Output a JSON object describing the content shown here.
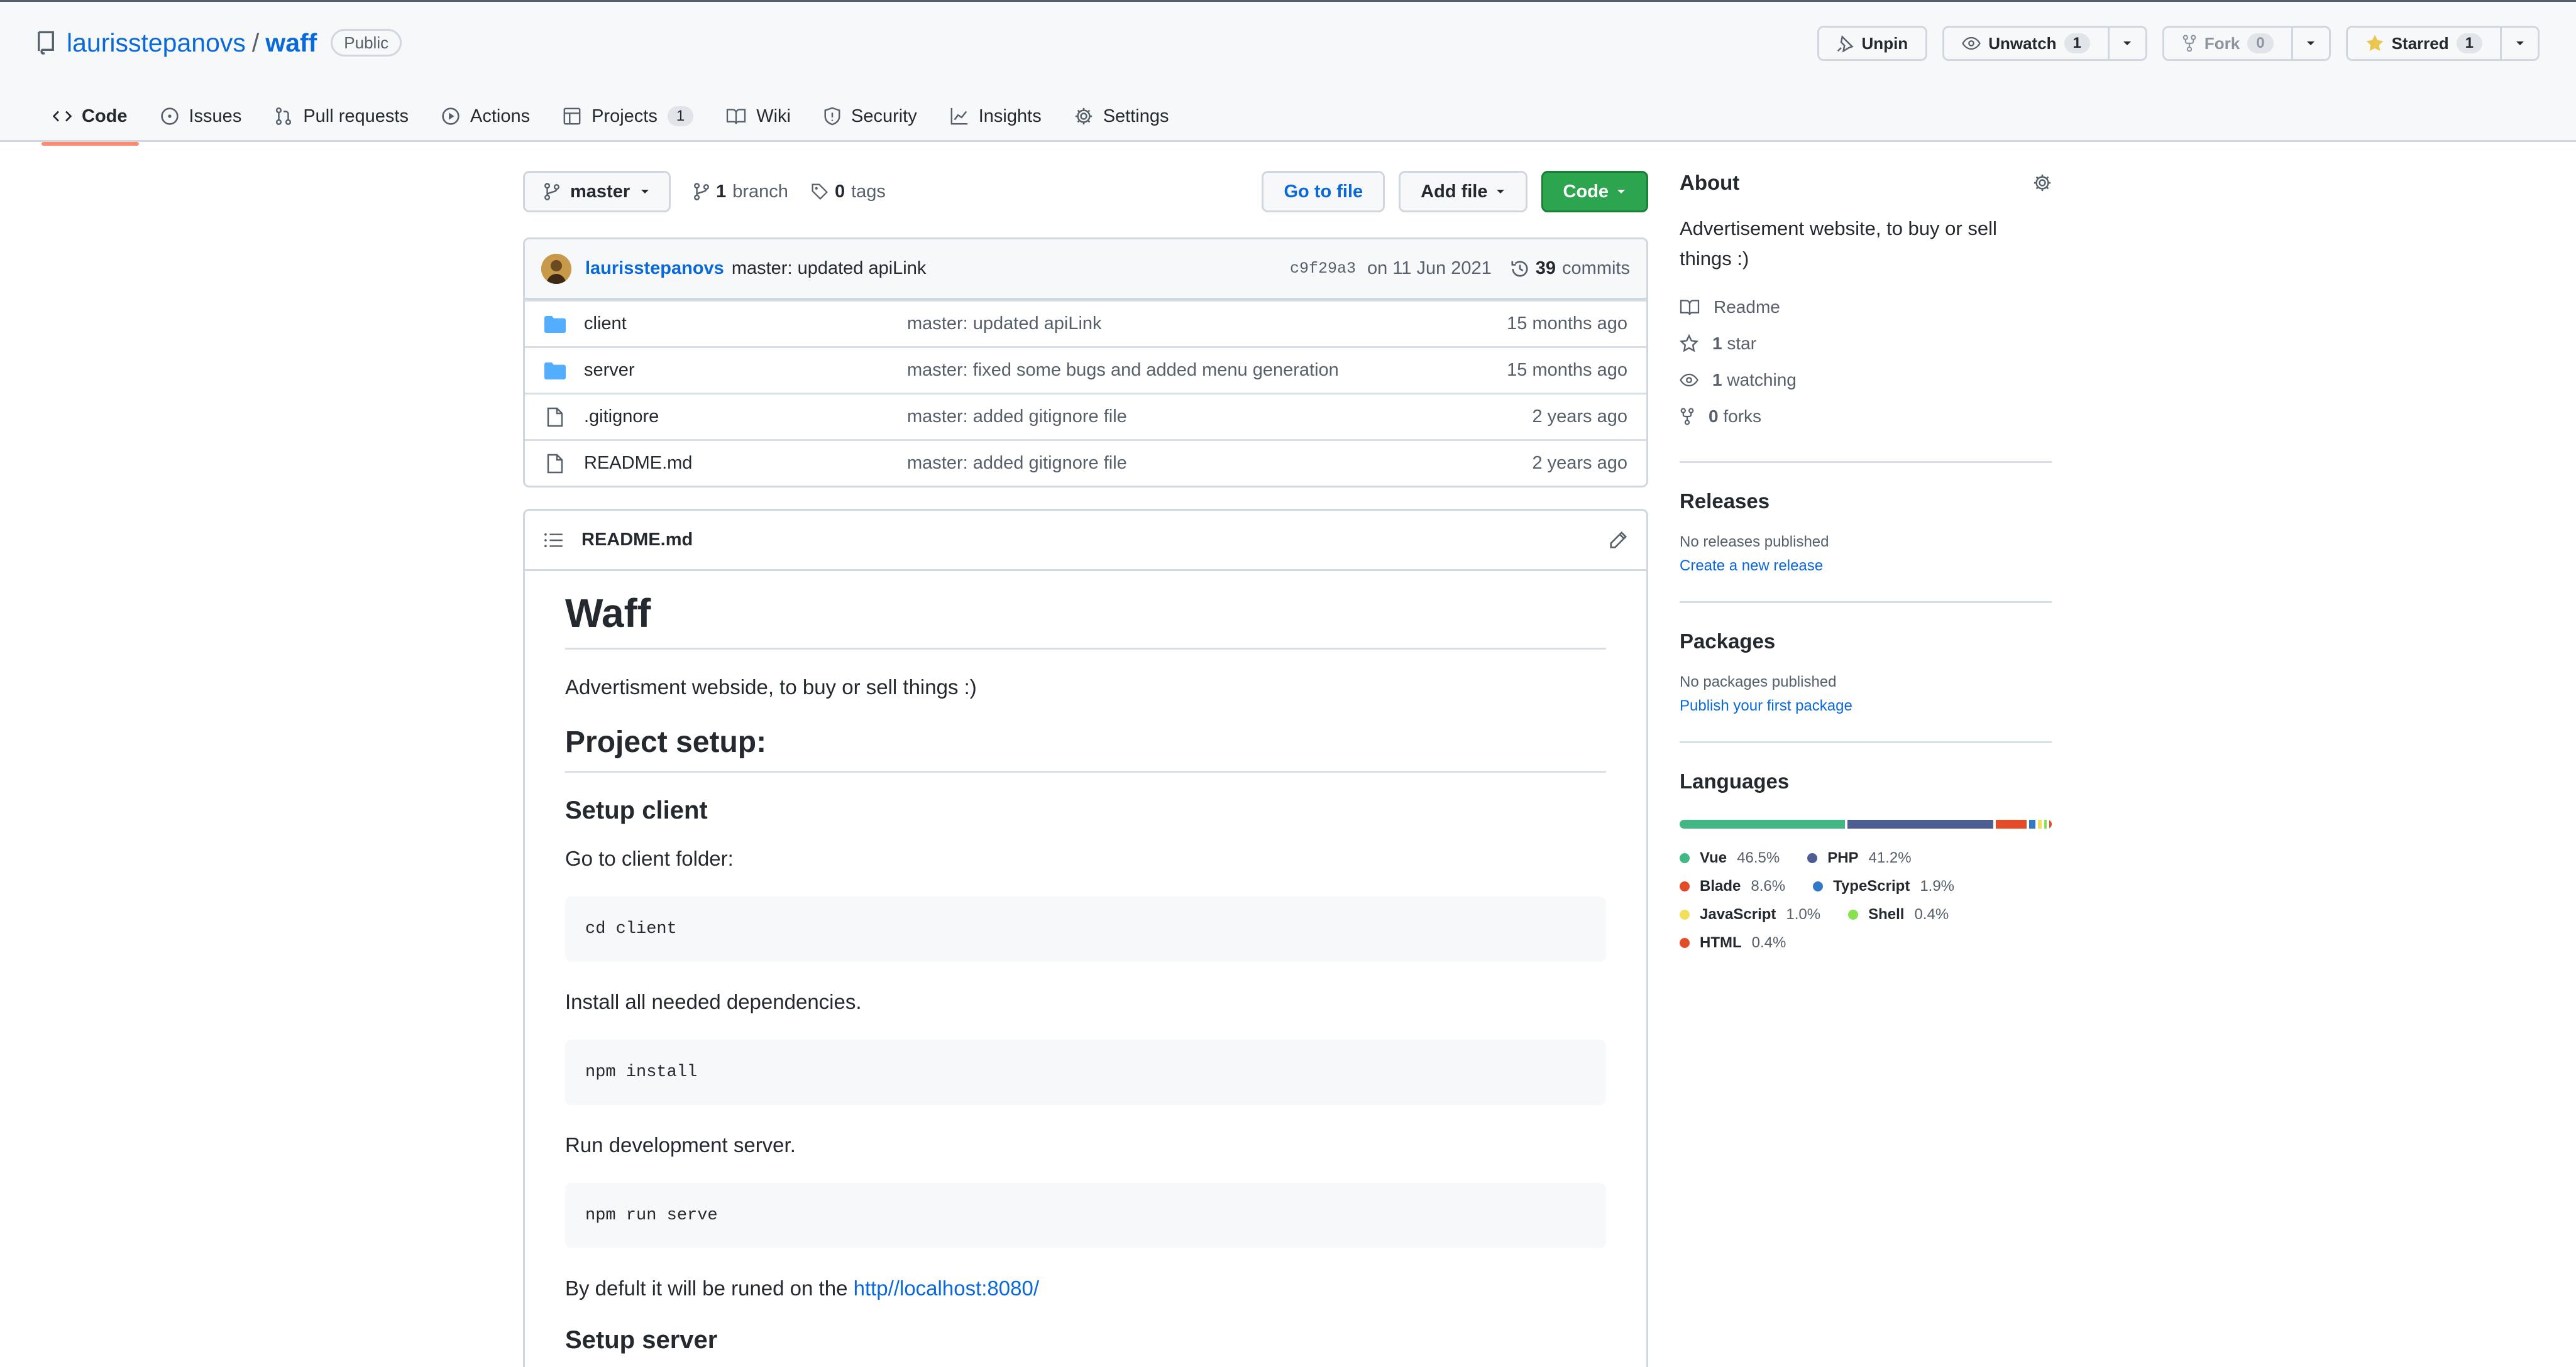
{
  "repo": {
    "owner": "laurisstepanovs",
    "separator": "/",
    "name": "waff",
    "visibility": "Public"
  },
  "actions": {
    "unpin": "Unpin",
    "unwatch": "Unwatch",
    "watch_count": "1",
    "fork": "Fork",
    "fork_count": "0",
    "starred": "Starred",
    "star_count": "1"
  },
  "tabs": [
    {
      "label": "Code",
      "icon": "code-icon"
    },
    {
      "label": "Issues",
      "icon": "issue-opened-icon"
    },
    {
      "label": "Pull requests",
      "icon": "git-pull-request-icon"
    },
    {
      "label": "Actions",
      "icon": "play-icon"
    },
    {
      "label": "Projects",
      "icon": "table-icon",
      "count": "1"
    },
    {
      "label": "Wiki",
      "icon": "book-icon"
    },
    {
      "label": "Security",
      "icon": "shield-icon"
    },
    {
      "label": "Insights",
      "icon": "graph-icon"
    },
    {
      "label": "Settings",
      "icon": "gear-icon"
    }
  ],
  "toolbar": {
    "branch": "master",
    "branch_count": "1",
    "branch_label": "branch",
    "tag_count": "0",
    "tag_label": "tags",
    "go_to_file": "Go to file",
    "add_file": "Add file",
    "code": "Code"
  },
  "commit": {
    "author": "laurisstepanovs",
    "message": "master: updated apiLink",
    "sha": "c9f29a3",
    "date": "on 11 Jun 2021",
    "count": "39",
    "count_label": "commits"
  },
  "files": [
    {
      "type": "dir",
      "name": "client",
      "message": "master: updated apiLink",
      "age": "15 months ago"
    },
    {
      "type": "dir",
      "name": "server",
      "message": "master: fixed some bugs and added menu generation",
      "age": "15 months ago"
    },
    {
      "type": "file",
      "name": ".gitignore",
      "message": "master: added gitignore file",
      "age": "2 years ago"
    },
    {
      "type": "file",
      "name": "README.md",
      "message": "master: added gitignore file",
      "age": "2 years ago"
    }
  ],
  "readme": {
    "filename": "README.md",
    "h1": "Waff",
    "intro": "Advertisment webside, to buy or sell things :)",
    "h2_setup": "Project setup:",
    "h3_client": "Setup client",
    "p_goto": "Go to client folder:",
    "code_cd": "cd client",
    "p_install": "Install all needed dependencies.",
    "code_install": "npm install",
    "p_run": "Run development server.",
    "code_serve": "npm run serve",
    "p_default_prefix": "By defult it will be runed on the ",
    "default_link": "http//localhost:8080/",
    "h3_server": "Setup server"
  },
  "about": {
    "heading": "About",
    "description": "Advertisement website, to buy or sell things :)",
    "readme": "Readme",
    "stars_count": "1",
    "stars_label": "star",
    "watching_count": "1",
    "watching_label": "watching",
    "forks_count": "0",
    "forks_label": "forks"
  },
  "releases": {
    "heading": "Releases",
    "empty": "No releases published",
    "link": "Create a new release"
  },
  "packages": {
    "heading": "Packages",
    "empty": "No packages published",
    "link": "Publish your first package"
  },
  "languages": {
    "heading": "Languages",
    "items": [
      {
        "name": "Vue",
        "pct": "46.5%",
        "value": 46.5,
        "color": "#41b883"
      },
      {
        "name": "PHP",
        "pct": "41.2%",
        "value": 41.2,
        "color": "#4F5D95"
      },
      {
        "name": "Blade",
        "pct": "8.6%",
        "value": 8.6,
        "color": "#e34c26"
      },
      {
        "name": "TypeScript",
        "pct": "1.9%",
        "value": 1.9,
        "color": "#3178c6"
      },
      {
        "name": "JavaScript",
        "pct": "1.0%",
        "value": 1.0,
        "color": "#f1e05a"
      },
      {
        "name": "Shell",
        "pct": "0.4%",
        "value": 0.4,
        "color": "#89e051"
      },
      {
        "name": "HTML",
        "pct": "0.4%",
        "value": 0.4,
        "color": "#e34c26"
      }
    ]
  }
}
